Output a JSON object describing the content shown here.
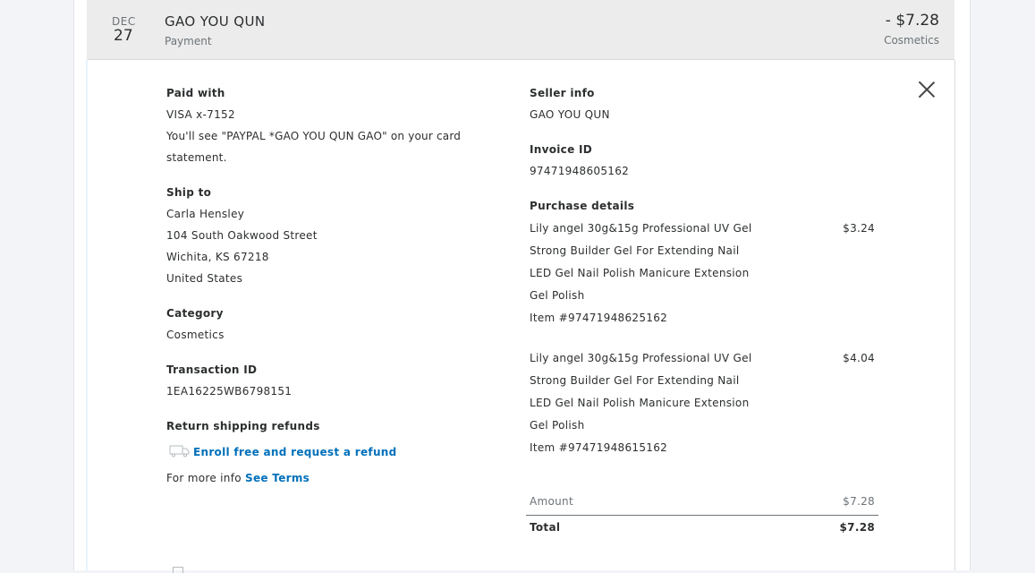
{
  "transaction": {
    "month": "DEC",
    "day": "27",
    "merchant": "GAO YOU QUN",
    "type": "Payment",
    "amount": "- $7.28",
    "category": "Cosmetics"
  },
  "paid_with": {
    "label": "Paid with",
    "card": "VISA x-7152",
    "note": "You'll see \"PAYPAL *GAO YOU QUN GAO\" on your card statement."
  },
  "ship_to": {
    "label": "Ship to",
    "name": "Carla Hensley",
    "street": "104 South Oakwood Street",
    "city": "Wichita, KS 67218",
    "country": "United States"
  },
  "category": {
    "label": "Category",
    "value": "Cosmetics"
  },
  "transaction_id": {
    "label": "Transaction ID",
    "value": "1EA16225WB6798151"
  },
  "return_shipping": {
    "label": "Return shipping refunds",
    "enroll_link": "Enroll free and request a refund",
    "more_info_text": "For more info",
    "terms_link": "See Terms"
  },
  "seller": {
    "label": "Seller info",
    "value": "GAO YOU QUN"
  },
  "invoice": {
    "label": "Invoice ID",
    "value": "97471948605162"
  },
  "purchase": {
    "label": "Purchase details",
    "items": [
      {
        "line1": "Lily angel 30g&15g Professional UV Gel",
        "line2": "Strong Builder Gel For Extending Nail",
        "line3": "LED Gel Nail Polish Manicure Extension",
        "line4": "Gel Polish",
        "item_no": "Item #97471948625162",
        "price": "$3.24"
      },
      {
        "line1": "Lily angel 30g&15g Professional UV Gel",
        "line2": "Strong Builder Gel For Extending Nail",
        "line3": "LED Gel Nail Polish Manicure Extension",
        "line4": "Gel Polish",
        "item_no": "Item #97471948615162",
        "price": "$4.04"
      }
    ],
    "amount_label": "Amount",
    "amount_value": "$7.28",
    "total_label": "Total",
    "total_value": "$7.28"
  },
  "colors": {
    "link": "#0070ba",
    "header_bg": "#ececec",
    "page_bg": "#f2f4f7"
  },
  "icons": {
    "close": "close-icon",
    "truck": "truck-icon"
  }
}
